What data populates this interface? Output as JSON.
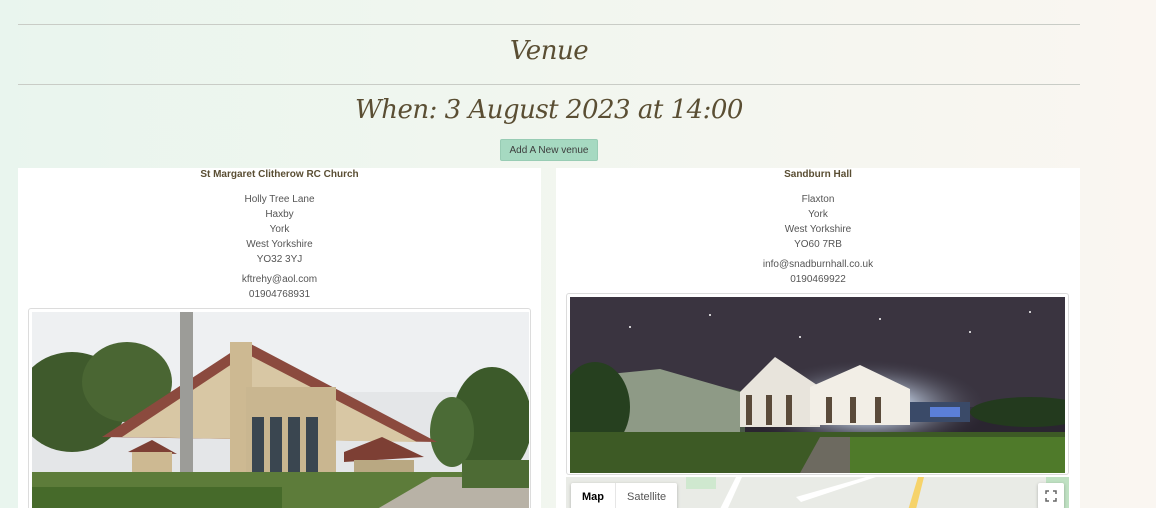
{
  "page": {
    "heading": "Venue",
    "when": "When: 3 August 2023 at 14:00",
    "add_venue_label": "Add A New venue"
  },
  "colors": {
    "heading": "#5a4e33",
    "button_bg": "#a6d9c1",
    "card_bg": "#ffffff"
  },
  "venues": [
    {
      "name": "St Margaret Clitherow RC Church",
      "address": [
        "Holly Tree Lane",
        "Haxby",
        "York",
        "West Yorkshire",
        "YO32 3YJ"
      ],
      "email": "kftrehy@aol.com",
      "phone": "01904768931"
    },
    {
      "name": "Sandburn Hall",
      "address": [
        "Flaxton",
        "York",
        "West Yorkshire",
        "YO60 7RB"
      ],
      "email": "info@snadburnhall.co.uk",
      "phone": "0190469922"
    }
  ],
  "map": {
    "tab_map": "Map",
    "tab_satellite": "Satellite",
    "fullscreen_icon": "fullscreen-icon"
  }
}
